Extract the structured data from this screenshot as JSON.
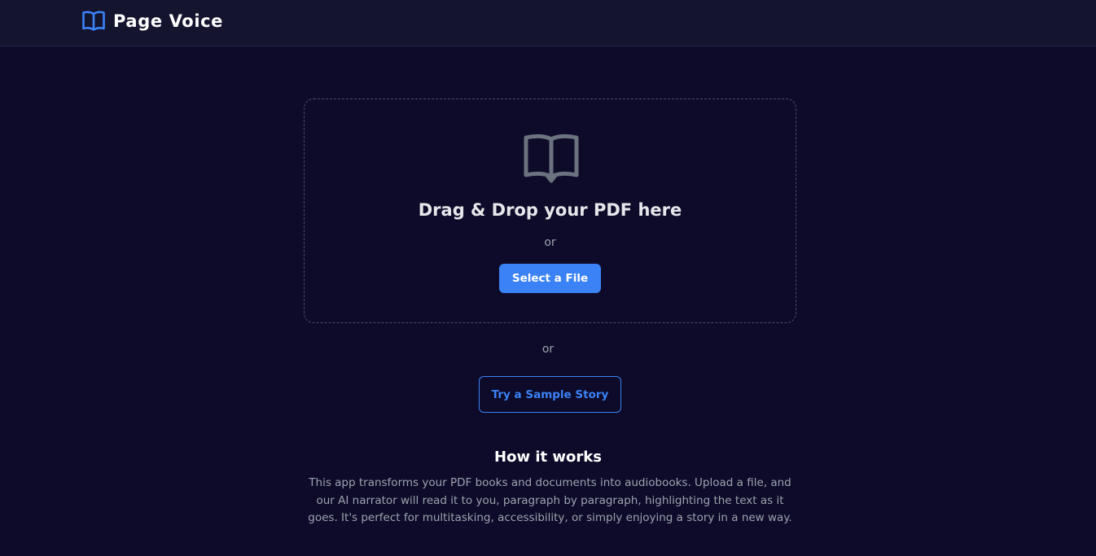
{
  "app": {
    "title": "Page Voice",
    "brand_icon": "open-book-icon",
    "accent_color": "#3b82f6"
  },
  "upload": {
    "icon": "open-book-icon",
    "title": "Drag & Drop your PDF here",
    "or_text": "or",
    "select_label": "Select a File"
  },
  "alt": {
    "or_text": "or",
    "sample_label": "Try a Sample Story"
  },
  "how": {
    "title": "How it works",
    "description": "This app transforms your PDF books and documents into audiobooks. Upload a file, and our AI narrator will read it to you, paragraph by paragraph, highlighting the text as it goes. It's perfect for multitasking, accessibility, or simply enjoying a story in a new way."
  }
}
